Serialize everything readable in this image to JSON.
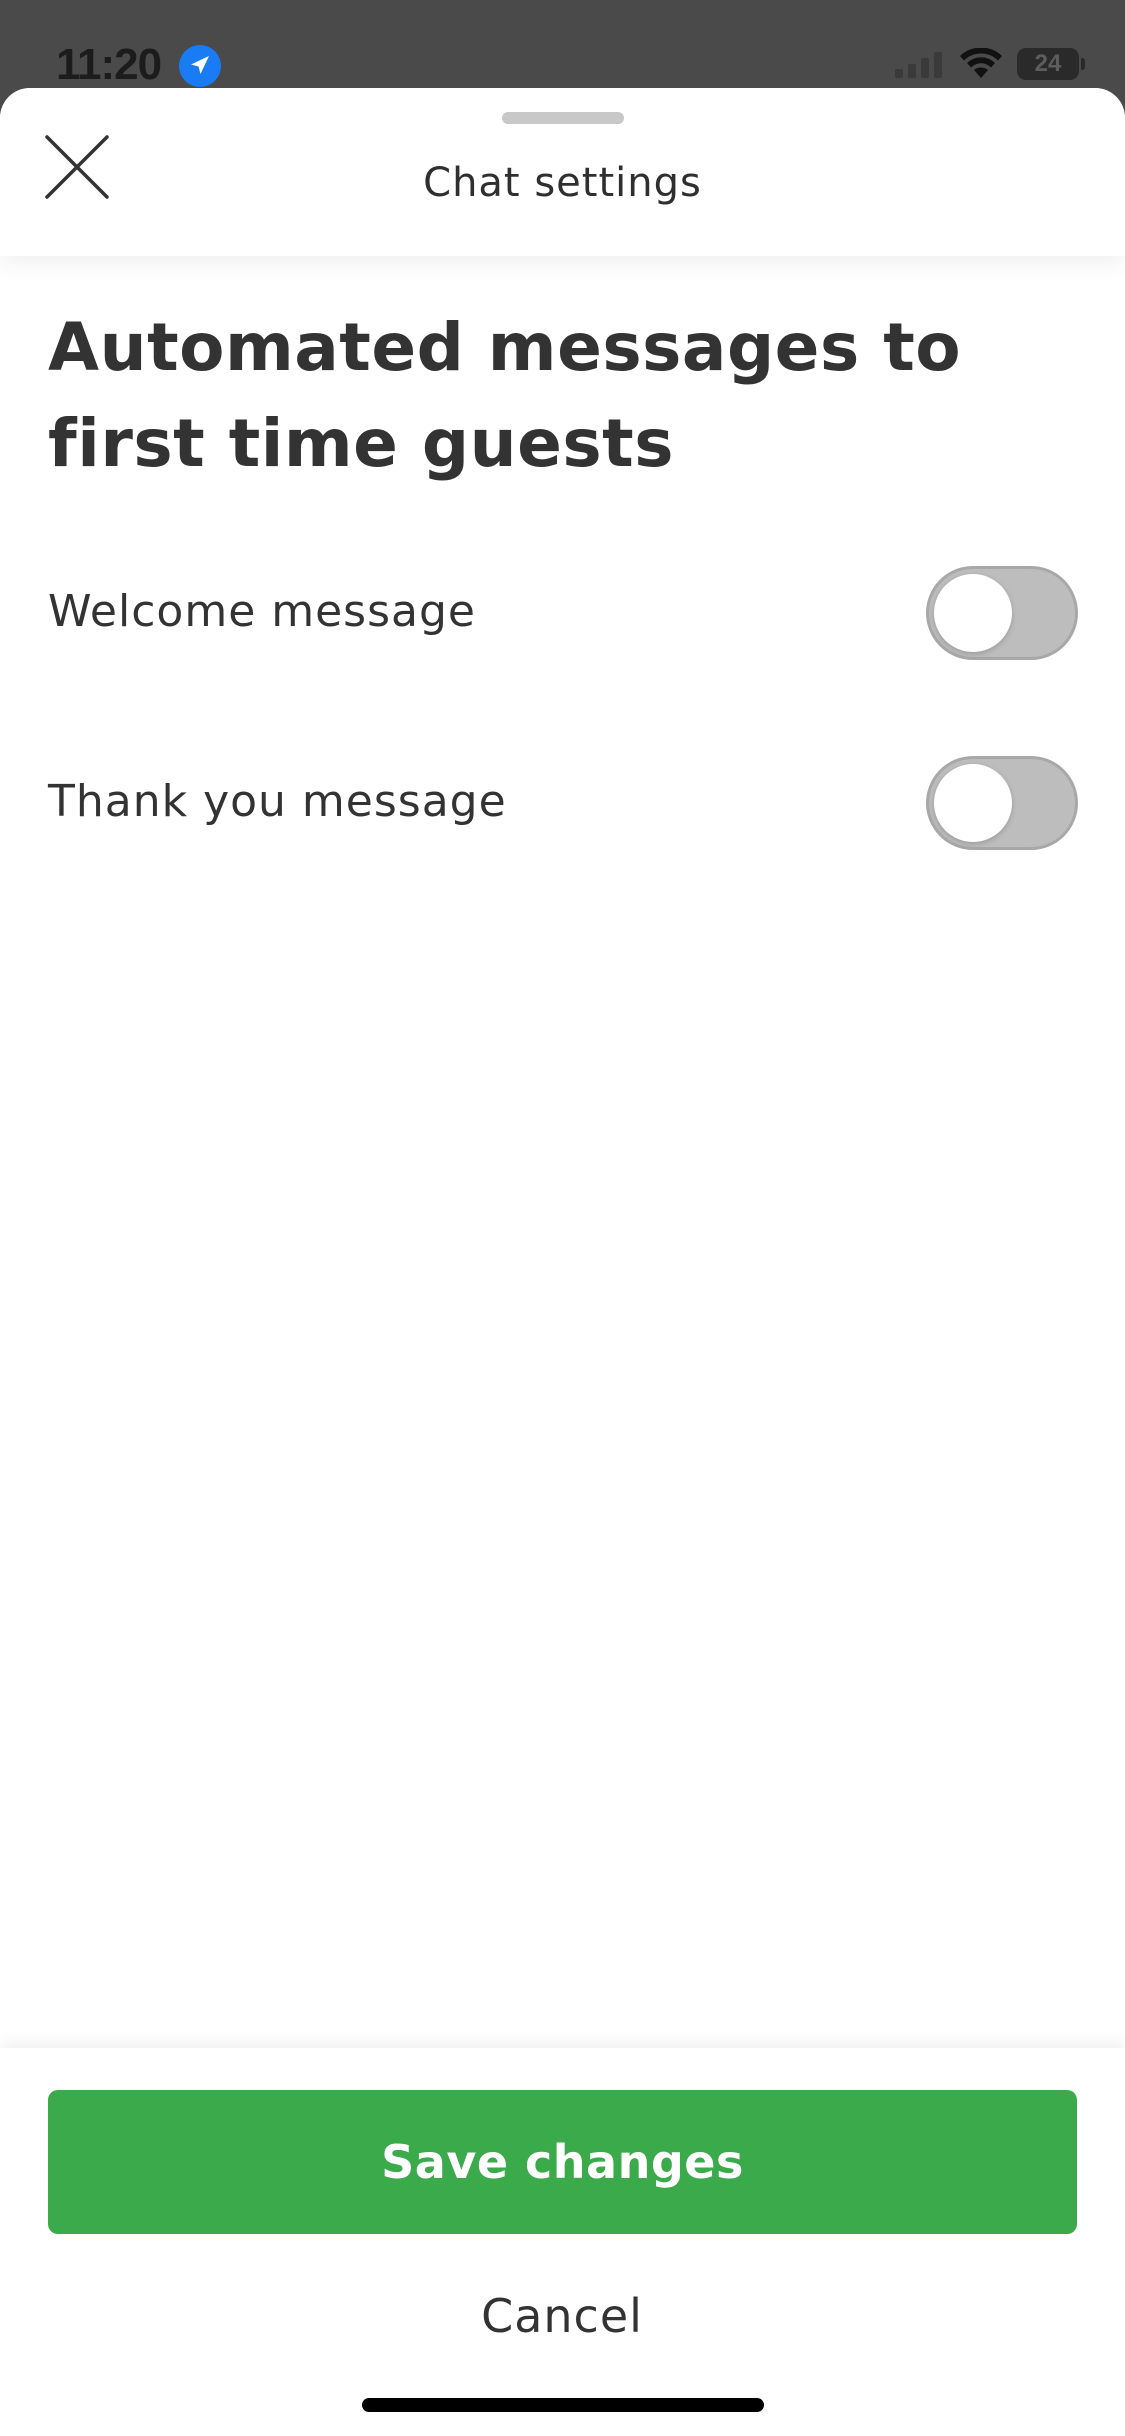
{
  "status_bar": {
    "time": "11:20",
    "battery": "24",
    "location_icon": "location-arrow-icon",
    "signal_icon": "cellular-signal-icon",
    "wifi_icon": "wifi-icon"
  },
  "header": {
    "title": "Chat settings",
    "close_icon": "close-icon"
  },
  "section": {
    "title": "Automated messages to first time guests"
  },
  "settings": [
    {
      "label": "Welcome message",
      "enabled": false
    },
    {
      "label": "Thank you message",
      "enabled": false
    }
  ],
  "footer": {
    "save_label": "Save changes",
    "cancel_label": "Cancel"
  },
  "colors": {
    "accent": "#3aaa4b",
    "toggle_off": "#bdbdbd",
    "text": "#333333",
    "location_badge": "#1a7cf5"
  }
}
